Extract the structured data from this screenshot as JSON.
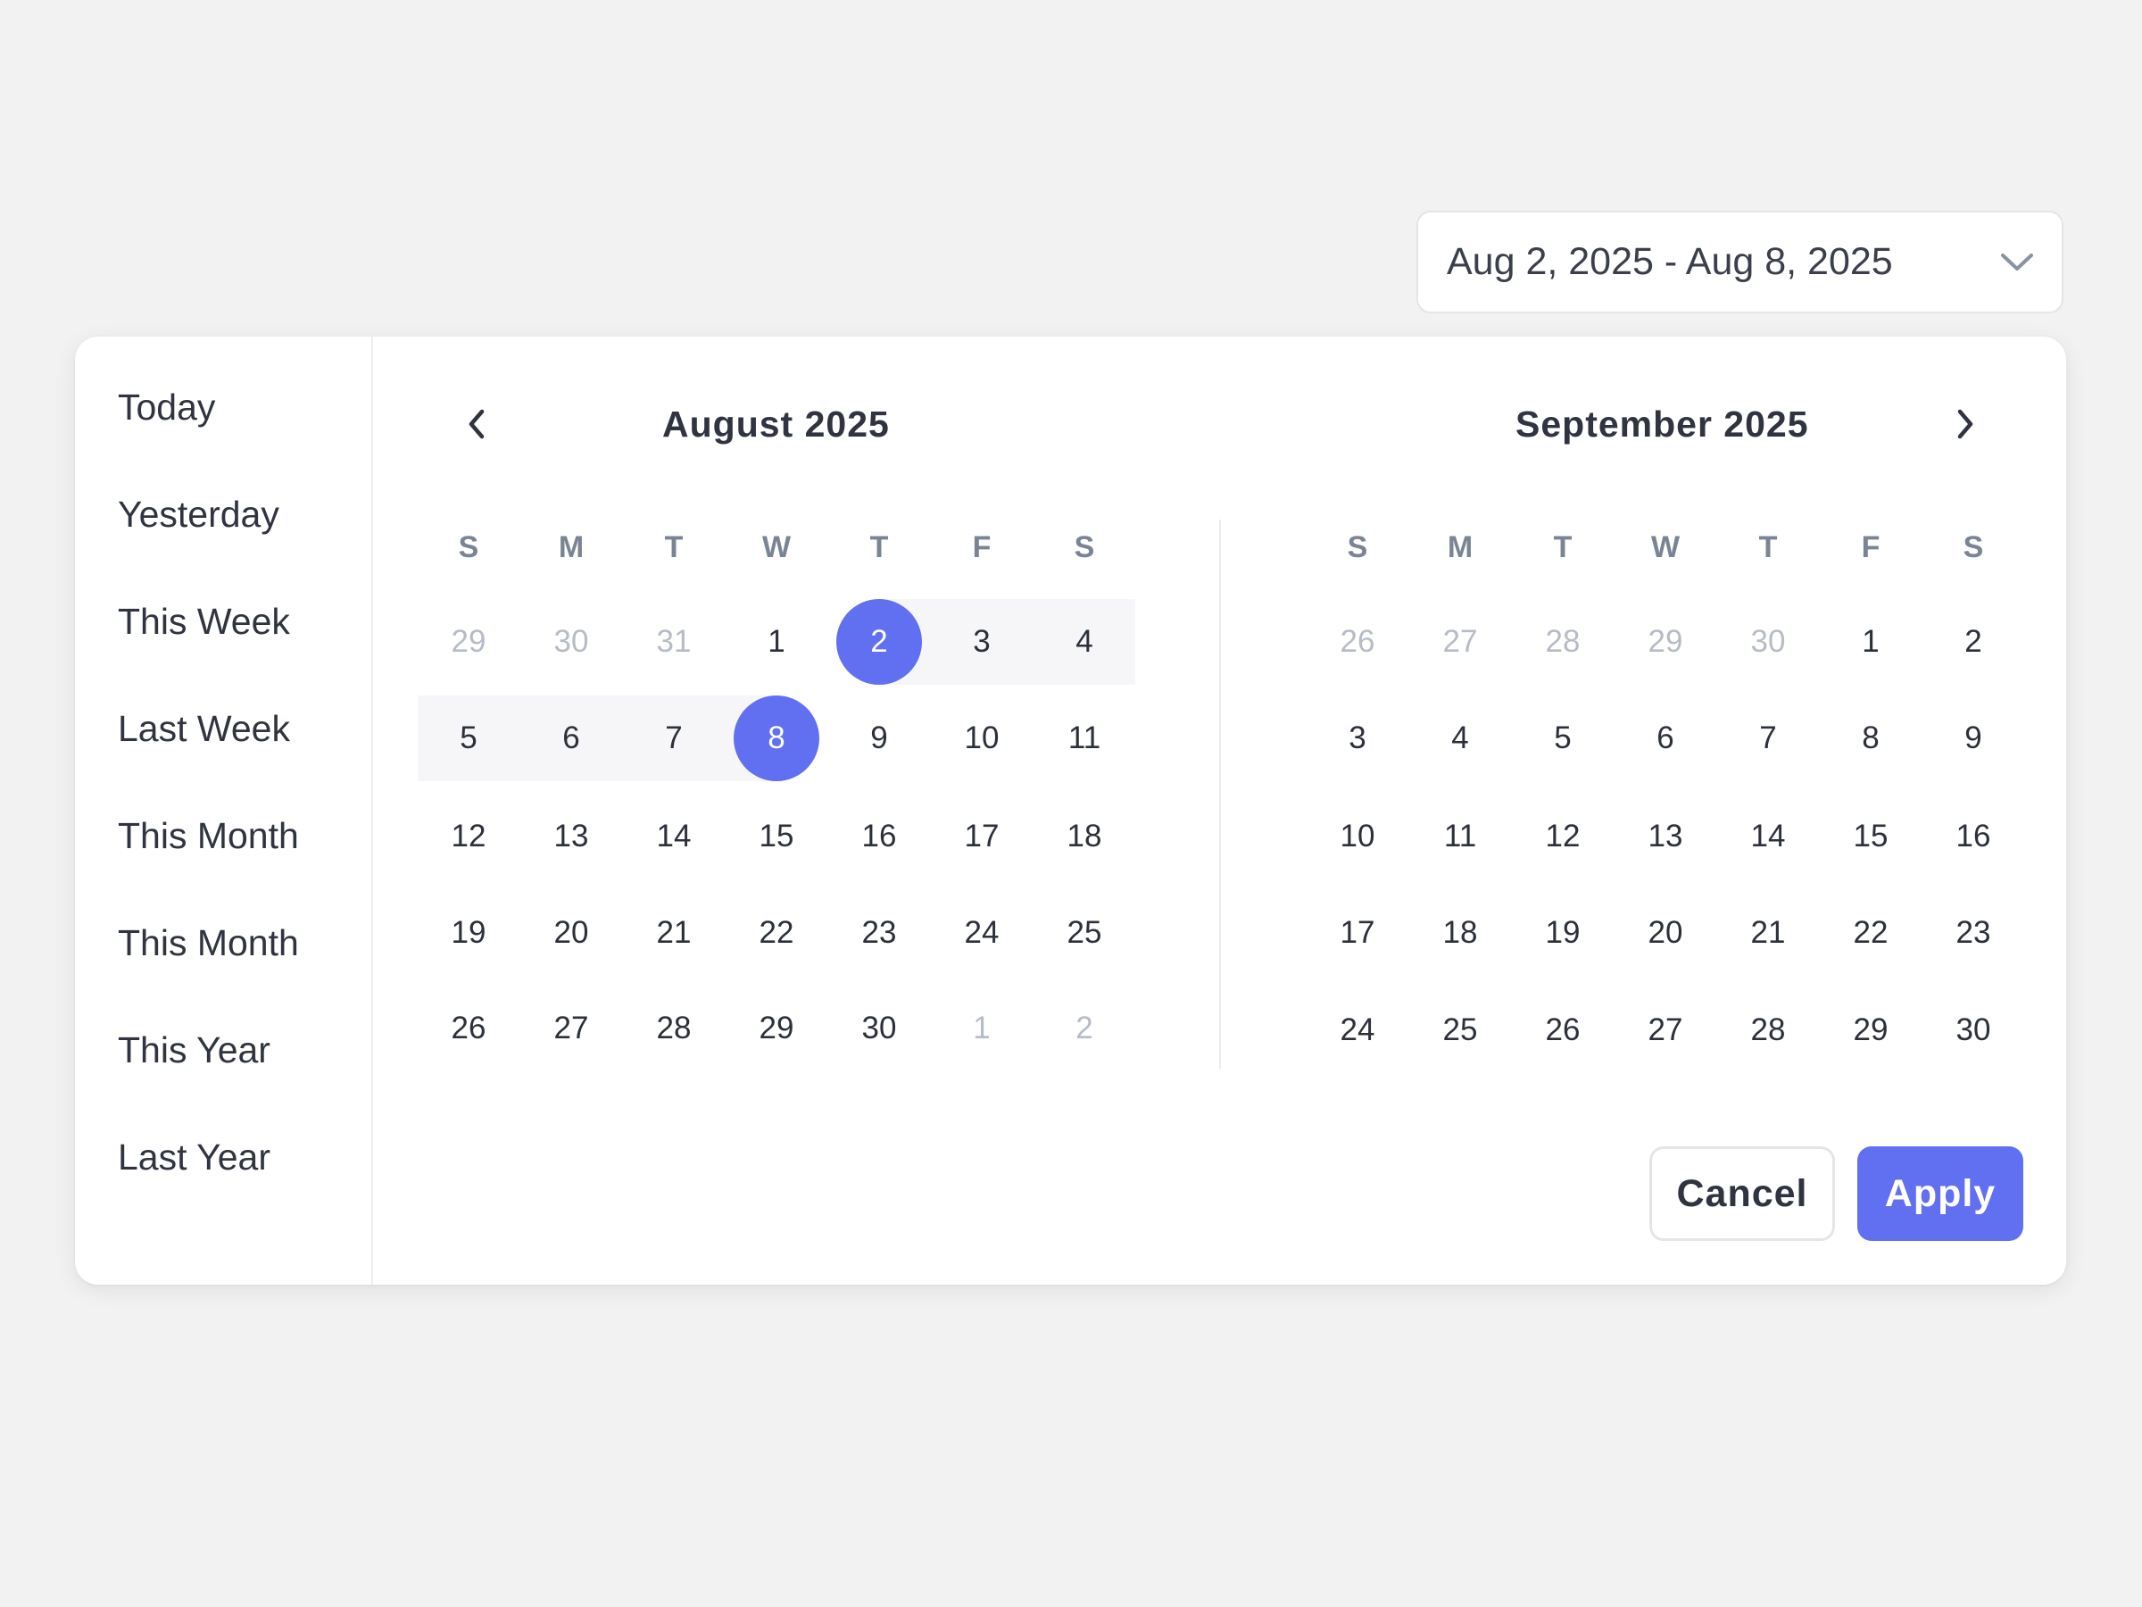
{
  "date_range_input": {
    "value": "Aug 2, 2025 - Aug 8, 2025",
    "icon": "chevron-down-icon"
  },
  "presets": [
    "Today",
    "Yesterday",
    "This Week",
    "Last Week",
    "This Month",
    "This Month",
    "This Year",
    "Last Year"
  ],
  "calendars": [
    {
      "title": "August 2025",
      "weekdays": [
        "S",
        "M",
        "T",
        "W",
        "T",
        "F",
        "S"
      ],
      "weeks": [
        [
          {
            "d": "29",
            "m": true
          },
          {
            "d": "30",
            "m": true
          },
          {
            "d": "31",
            "m": true
          },
          {
            "d": "1"
          },
          {
            "d": "2",
            "sel": true
          },
          {
            "d": "3"
          },
          {
            "d": "4"
          }
        ],
        [
          {
            "d": "5"
          },
          {
            "d": "6"
          },
          {
            "d": "7"
          },
          {
            "d": "8",
            "sel": true
          },
          {
            "d": "9"
          },
          {
            "d": "10"
          },
          {
            "d": "11"
          }
        ],
        [
          {
            "d": "12"
          },
          {
            "d": "13"
          },
          {
            "d": "14"
          },
          {
            "d": "15"
          },
          {
            "d": "16"
          },
          {
            "d": "17"
          },
          {
            "d": "18"
          }
        ],
        [
          {
            "d": "19"
          },
          {
            "d": "20"
          },
          {
            "d": "21"
          },
          {
            "d": "22"
          },
          {
            "d": "23"
          },
          {
            "d": "24"
          },
          {
            "d": "25"
          }
        ],
        [
          {
            "d": "26"
          },
          {
            "d": "27"
          },
          {
            "d": "28"
          },
          {
            "d": "29"
          },
          {
            "d": "30"
          },
          {
            "d": "1",
            "m": true
          },
          {
            "d": "2",
            "m": true
          }
        ]
      ]
    },
    {
      "title": "September 2025",
      "weekdays": [
        "S",
        "M",
        "T",
        "W",
        "T",
        "F",
        "S"
      ],
      "weeks": [
        [
          {
            "d": "26",
            "m": true
          },
          {
            "d": "27",
            "m": true
          },
          {
            "d": "28",
            "m": true
          },
          {
            "d": "29",
            "m": true
          },
          {
            "d": "30",
            "m": true
          },
          {
            "d": "1"
          },
          {
            "d": "2"
          }
        ],
        [
          {
            "d": "3"
          },
          {
            "d": "4"
          },
          {
            "d": "5"
          },
          {
            "d": "6"
          },
          {
            "d": "7"
          },
          {
            "d": "8"
          },
          {
            "d": "9"
          }
        ],
        [
          {
            "d": "10"
          },
          {
            "d": "11"
          },
          {
            "d": "12"
          },
          {
            "d": "13"
          },
          {
            "d": "14"
          },
          {
            "d": "15"
          },
          {
            "d": "16"
          }
        ],
        [
          {
            "d": "17"
          },
          {
            "d": "18"
          },
          {
            "d": "19"
          },
          {
            "d": "20"
          },
          {
            "d": "21"
          },
          {
            "d": "22"
          },
          {
            "d": "23"
          }
        ],
        [
          {
            "d": "24"
          },
          {
            "d": "25"
          },
          {
            "d": "26"
          },
          {
            "d": "27"
          },
          {
            "d": "28"
          },
          {
            "d": "29"
          },
          {
            "d": "30"
          }
        ]
      ]
    }
  ],
  "nav": {
    "prev_icon": "chevron-left-icon",
    "next_icon": "chevron-right-icon"
  },
  "actions": {
    "cancel_label": "Cancel",
    "apply_label": "Apply"
  },
  "colors": {
    "accent": "#6170f1",
    "range_band": "#f6f6f8",
    "muted_text": "#b6bcc7",
    "weekday_text": "#7a8494"
  }
}
